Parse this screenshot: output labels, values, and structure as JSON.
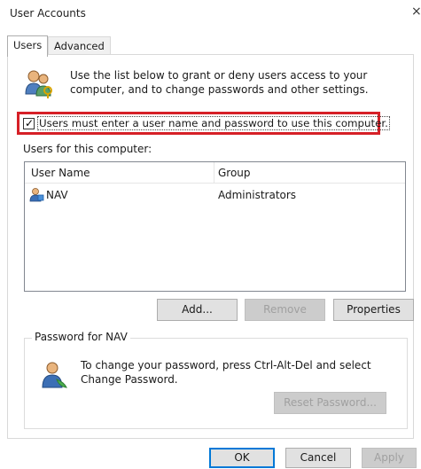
{
  "window": {
    "title": "User Accounts",
    "close_glyph": "×"
  },
  "tabs": [
    {
      "label": "Users",
      "active": true
    },
    {
      "label": "Advanced",
      "active": false
    }
  ],
  "intro": {
    "text": "Use the list below to grant or deny users access to your computer, and to change passwords and other settings.",
    "icon": "users-keys-icon"
  },
  "require_login": {
    "label": "Users must enter a user name and password to use this computer.",
    "checked": true,
    "highlight_color": "#d62027"
  },
  "users_list": {
    "label": "Users for this computer:",
    "columns": [
      "User Name",
      "Group"
    ],
    "rows": [
      {
        "name": "NAV",
        "group": "Administrators",
        "icon": "user-icon"
      }
    ]
  },
  "list_buttons": {
    "add": "Add...",
    "remove": "Remove",
    "properties": "Properties"
  },
  "password_group": {
    "title": "Password for NAV",
    "text": "To change your password, press Ctrl-Alt-Del and select Change Password.",
    "reset_button": "Reset Password...",
    "icon": "user-password-icon"
  },
  "footer": {
    "ok": "OK",
    "cancel": "Cancel",
    "apply": "Apply"
  },
  "colors": {
    "accent": "#0078d7",
    "disabled_text": "#a0a0a0"
  }
}
